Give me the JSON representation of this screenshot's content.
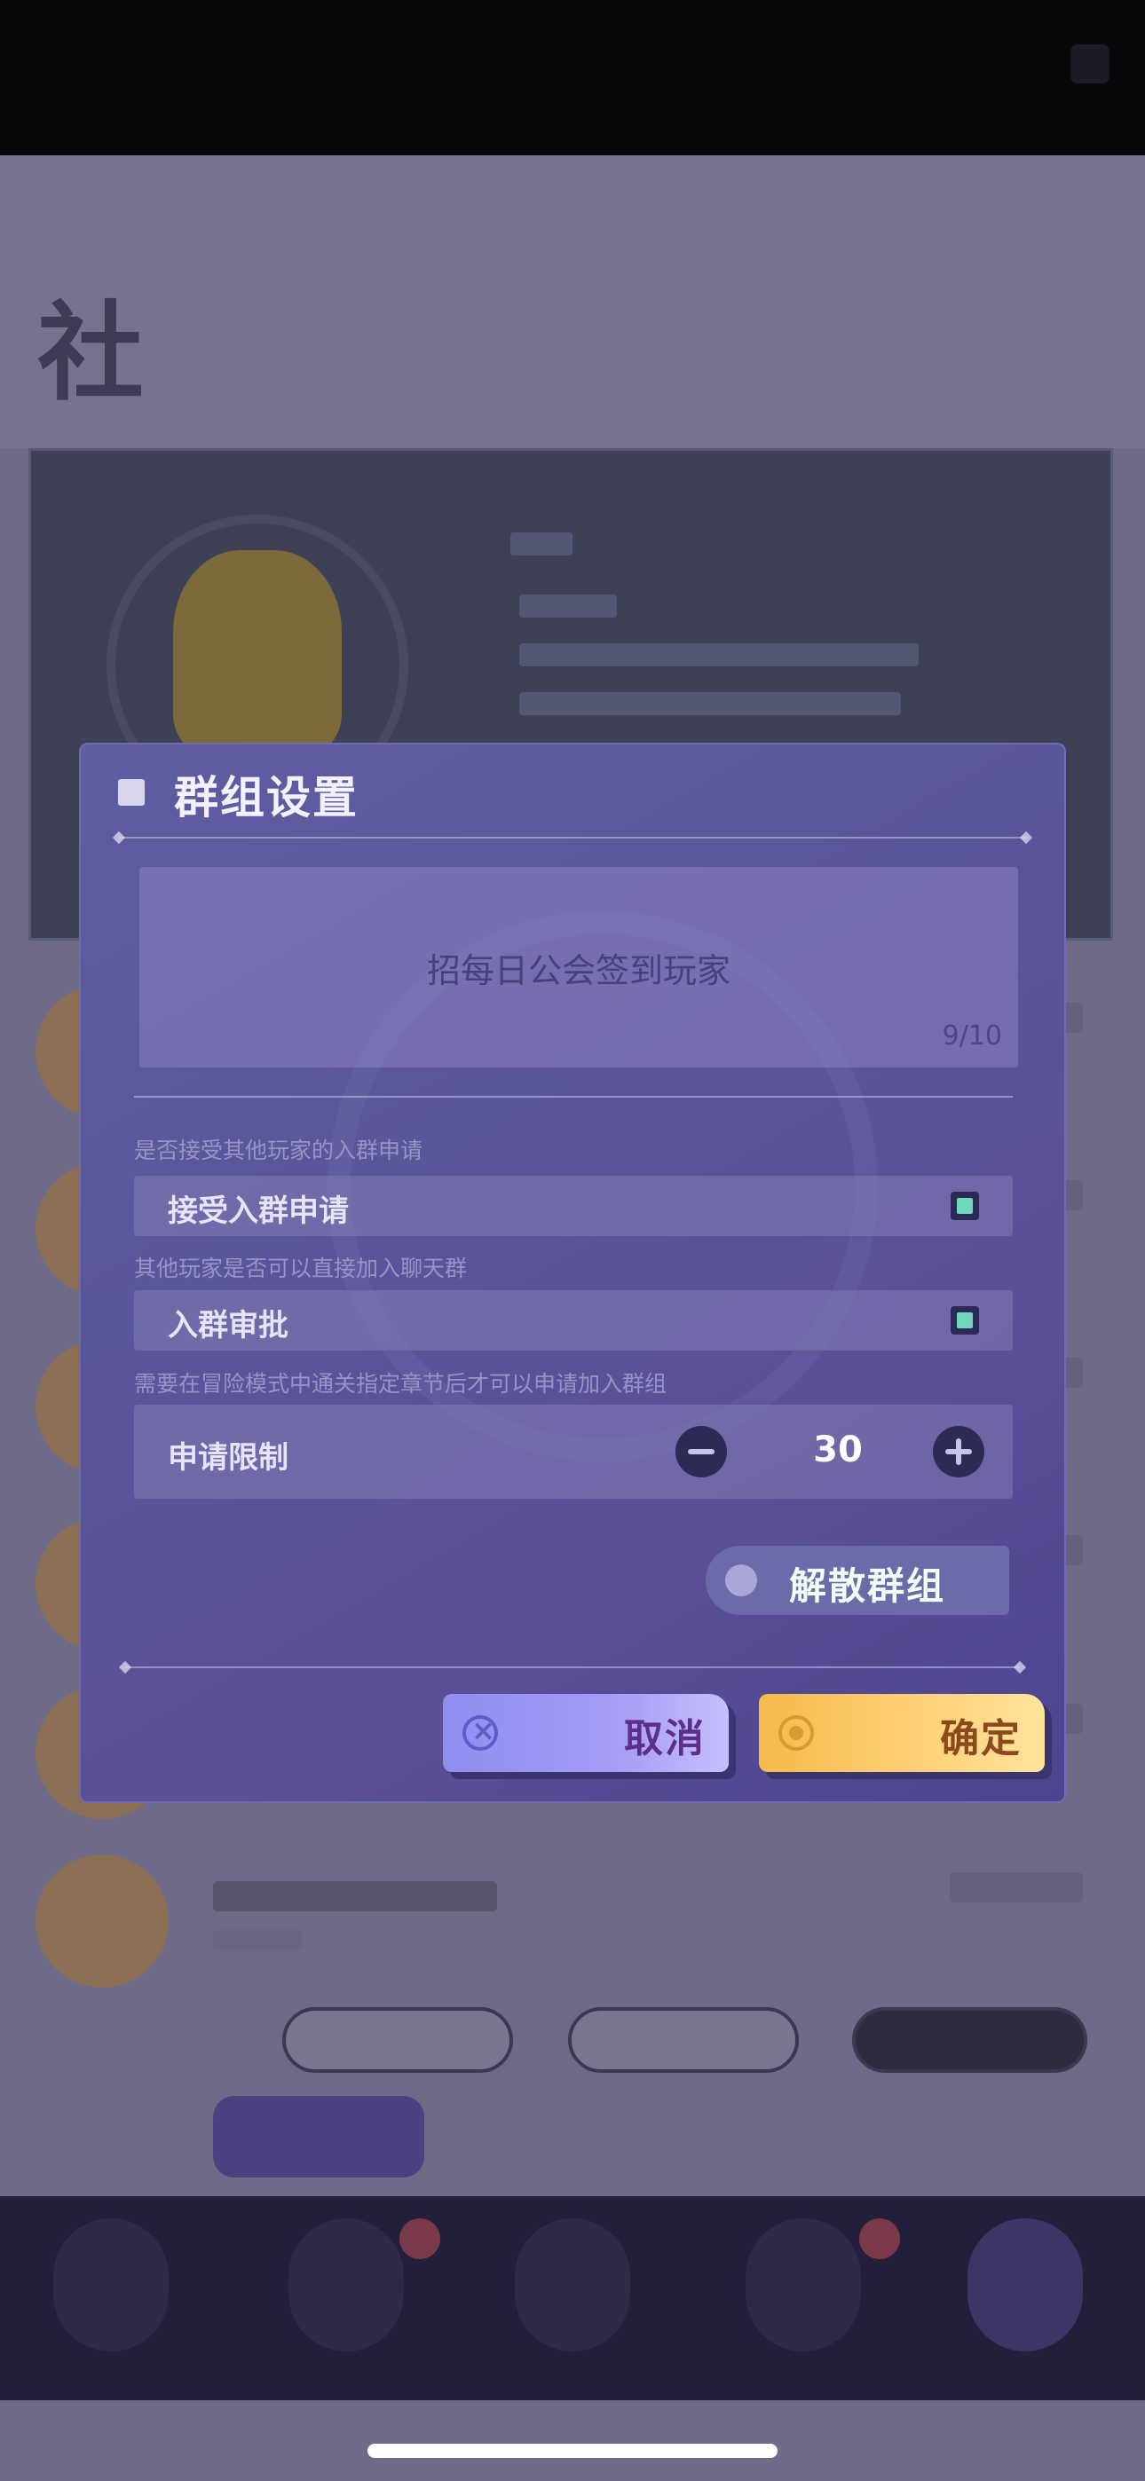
{
  "dialog": {
    "title": "群组设置",
    "description": {
      "text": "招每日公会签到玩家",
      "char_count": "9/10"
    },
    "options": [
      {
        "hint": "是否接受其他玩家的入群申请",
        "label": "接受入群申请",
        "checked": true
      },
      {
        "hint": "其他玩家是否可以直接加入聊天群",
        "label": "入群审批",
        "checked": true
      }
    ],
    "limit": {
      "hint": "需要在冒险模式中通关指定章节后才可以申请加入群组",
      "label": "申请限制",
      "value": "30"
    },
    "disband_label": "解散群组",
    "cancel_label": "取消",
    "confirm_label": "确定"
  },
  "colors": {
    "accent_green": "#6fd8b8",
    "confirm_yellow": "#ffd37a",
    "cancel_purple": "#a59cf5",
    "dialog_bg": "#5a559a"
  }
}
